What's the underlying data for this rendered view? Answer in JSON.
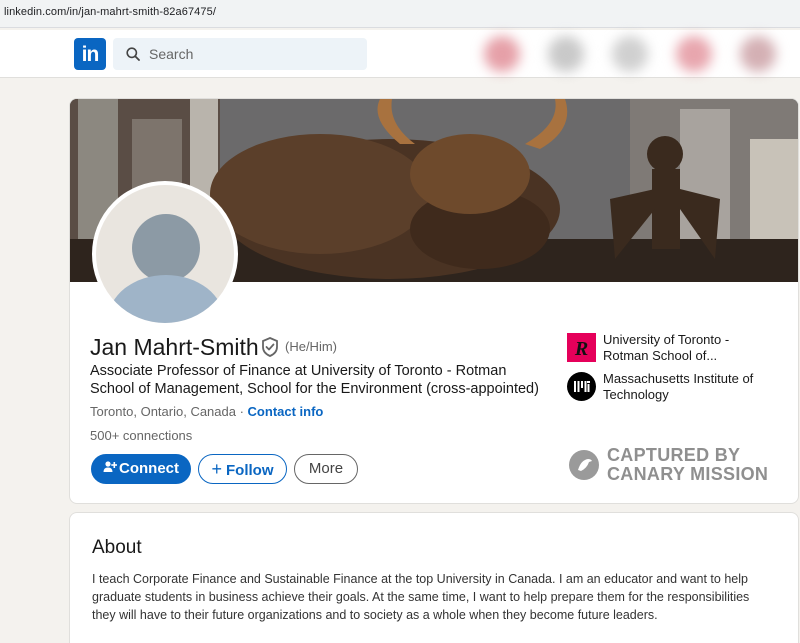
{
  "browser": {
    "url": "linkedin.com/in/jan-mahrt-smith-82a67475/"
  },
  "nav": {
    "logo_text": "in",
    "search_placeholder": "Search"
  },
  "profile": {
    "name": "Jan Mahrt-Smith",
    "pronouns": "(He/Him)",
    "headline": "Associate Professor of Finance at University of Toronto - Rotman School of Management, School for the Environment (cross-appointed)",
    "location": "Toronto, Ontario, Canada",
    "separator": " · ",
    "contact_info": "Contact info",
    "connections": "500+ connections"
  },
  "actions": {
    "connect": "Connect",
    "follow": "Follow",
    "more": "More"
  },
  "education": [
    {
      "name": "University of Toronto - Rotman School of...",
      "logo_glyph": "R",
      "logo_color": "#e5005a"
    },
    {
      "name": "Massachusetts Institute of Technology",
      "logo_glyph": "MIT",
      "logo_color": "#000000"
    }
  ],
  "watermark": {
    "line1": "CAPTURED BY",
    "line2": "CANARY MISSION"
  },
  "about": {
    "title": "About",
    "text": "I teach Corporate Finance and Sustainable Finance at the top University in Canada. I am an educator and want to help graduate students in business achieve their goals. At the same time, I want to help prepare them for the responsibilities they will have to their future organizations and to society as a whole when they become future leaders."
  },
  "colors": {
    "brand": "#0a66c2",
    "page_bg": "#f4f2ee"
  }
}
